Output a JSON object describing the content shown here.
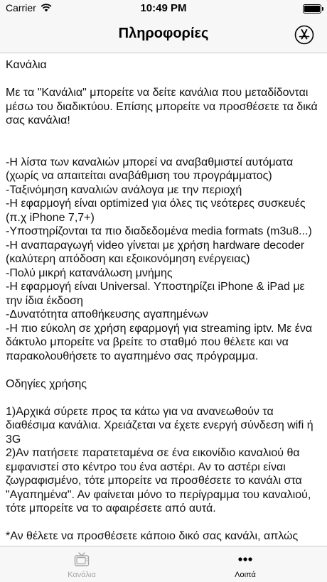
{
  "status_bar": {
    "carrier": "Carrier",
    "time": "10:49 PM"
  },
  "nav": {
    "title": "Πληροφορίες",
    "right_icon": "app-store-icon"
  },
  "content": {
    "p1": "Κανάλια",
    "p2": "Με τα \"Κανάλια\" μπορείτε να δείτε κανάλια που μεταδίδονται μέσω του διαδικτύου. Επίσης μπορείτε να προσθέσετε τα δικά σας κανάλια!",
    "f1": "-Η λίστα των καναλιών μπορεί να αναβαθμιστεί αυτόματα (χωρίς να απαιτείται αναβάθμιση του προγράμματος)",
    "f2": "-Ταξινόμηση καναλιών ανάλογα με την περιοχή",
    "f3": "-Η εφαρμογή είναι optimized για όλες τις νεότερες συσκευές (π.χ iPhone 7,7+)",
    "f4": "-Υποστηρίζονται τα πιο διαδεδομένα media formats (m3u8...)",
    "f5": "-Η αναπαραγωγή video γίνεται με χρήση hardware decoder (καλύτερη απόδοση και εξοικονόμηση ενέργειας)",
    "f6": "-Πολύ μικρή κατανάλωση μνήμης",
    "f7": "-Η εφαρμογή είναι Universal. Υποστηρίζει iPhone & iPad με την ίδια έκδοση",
    "f8": "-Δυνατότητα αποθήκευσης αγαπημένων",
    "f9": "-Η πιο εύκολη σε χρήση εφαρμογή για streaming iptv. Με ένα δάκτυλο μπορείτε να βρείτε το σταθμό που θέλετε και να παρακολουθήσετε το αγαπημένο σας πρόγραμμα.",
    "h2": "Οδηγίες χρήσης",
    "i1": "1)Αρχικά σύρετε προς τα κάτω για να ανανεωθούν τα διαθέσιμα κανάλια. Χρειάζεται να έχετε ενεργή σύνδεση wifi ή 3G",
    "i2": "2)Αν πατήσετε παρατεταμένα σε ένα εικονίδιο καναλιού θα εμφανιστεί στο κέντρο του ένα αστέρι. Αν το αστέρι είναι ζωγραφισμένο, τότε μπορείτε να προσθέσετε το κανάλι στα \"Αγαπημένα\". Αν φαίνεται μόνο το περίγραμμα του καναλιού, τότε μπορείτε να το αφαιρέσετε από αυτά.",
    "i3": "*Αν θέλετε να προσθέσετε κάποιο δικό σας κανάλι, απλώς επιλέξτε το σύμβολο \"+\" στο πάνω δεξί μέρος της οθόνης, και προσθέστε το κανάλι που θέλετε."
  },
  "tabs": [
    {
      "label": "Κανάλια",
      "icon": "tv-icon",
      "active": false
    },
    {
      "label": "Λοιπά",
      "icon": "more-icon",
      "active": true
    }
  ],
  "colors": {
    "bar_bg": "#f7f7f7",
    "inactive_tab": "#a6a6a6",
    "active_tab": "#000000"
  }
}
